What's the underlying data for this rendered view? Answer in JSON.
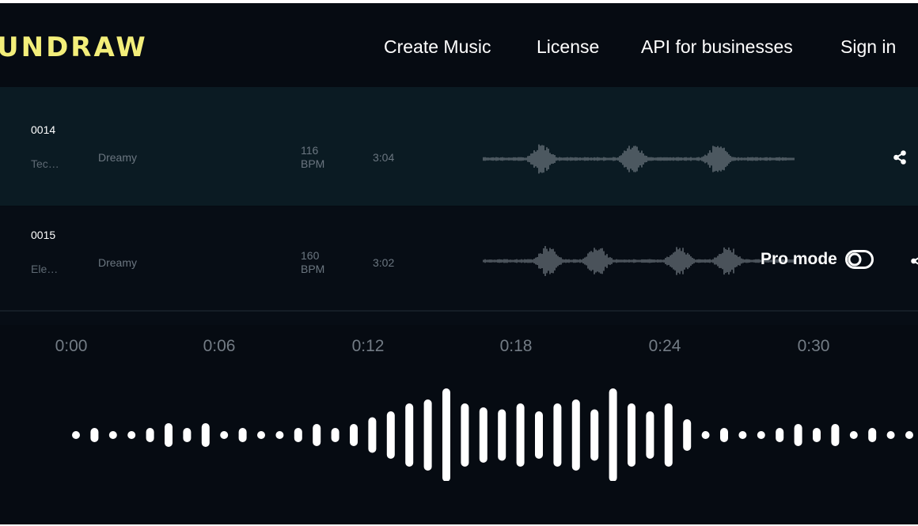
{
  "header": {
    "logo": "UNDRAW",
    "nav": [
      {
        "label": "Create Music"
      },
      {
        "label": "License"
      },
      {
        "label": "API for businesses"
      },
      {
        "label": "Sign in"
      }
    ]
  },
  "tracks": [
    {
      "id": "0014",
      "genre": "Tec…",
      "mood": "Dreamy",
      "bpm_value": "116",
      "bpm_unit": "BPM",
      "duration": "3:04",
      "share_icon": "share-icon"
    },
    {
      "id": "0015",
      "genre": "Ele…",
      "mood": "Dreamy",
      "bpm_value": "160",
      "bpm_unit": "BPM",
      "duration": "3:02",
      "share_icon": "share-icon"
    }
  ],
  "pro_mode": {
    "label": "Pro mode",
    "enabled": false,
    "icon": "toggle-off-icon"
  },
  "player": {
    "timeline": [
      "0:00",
      "0:06",
      "0:12",
      "0:18",
      "0:24",
      "0:30"
    ]
  },
  "colors": {
    "background": "#060b12",
    "logo": "#f3ee7a",
    "active_row": "#0b1b23",
    "waveform_small": "#8e969e",
    "waveform_large": "#ffffff",
    "muted_text": "#6b7680"
  }
}
